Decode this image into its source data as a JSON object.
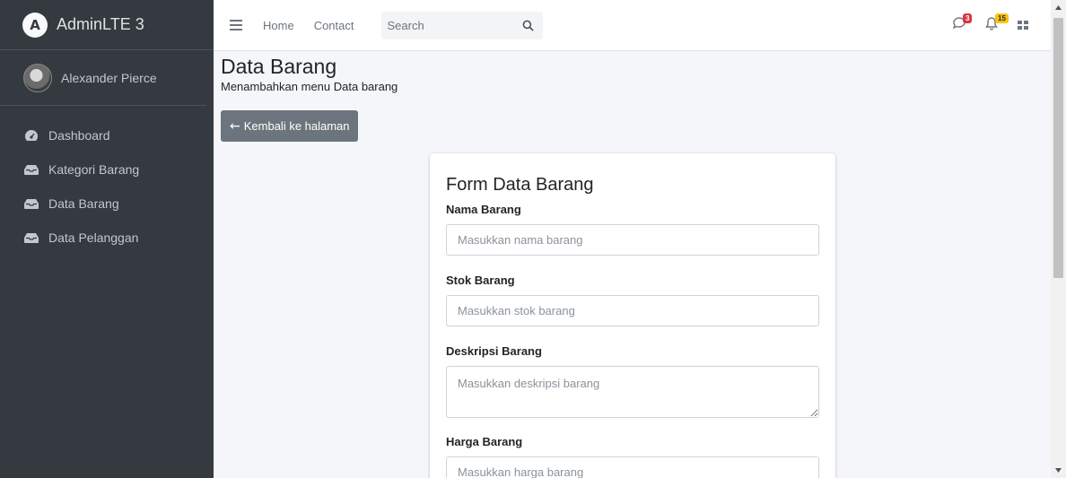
{
  "sidebar": {
    "brand": "AdminLTE 3",
    "brand_logo_letter": "A",
    "user_name": "Alexander Pierce",
    "items": [
      {
        "label": "Dashboard",
        "icon": "dashboard-icon"
      },
      {
        "label": "Kategori Barang",
        "icon": "inbox-icon"
      },
      {
        "label": "Data Barang",
        "icon": "inbox-icon"
      },
      {
        "label": "Data Pelanggan",
        "icon": "inbox-icon"
      }
    ]
  },
  "navbar": {
    "home_label": "Home",
    "contact_label": "Contact",
    "search_placeholder": "Search",
    "messages_badge": "3",
    "notifications_badge": "15"
  },
  "content": {
    "page_title": "Data Barang",
    "page_subtitle": "Menambahkan menu Data barang",
    "back_button_label": "Kembali ke halaman"
  },
  "form": {
    "title": "Form Data Barang",
    "fields": [
      {
        "label": "Nama Barang",
        "placeholder": "Masukkan nama barang"
      },
      {
        "label": "Stok Barang",
        "placeholder": "Masukkan stok barang"
      },
      {
        "label": "Deskripsi Barang",
        "placeholder": "Masukkan deskripsi barang"
      },
      {
        "label": "Harga Barang",
        "placeholder": "Masukkan harga barang"
      }
    ]
  },
  "colors": {
    "sidebar_bg": "#343a40",
    "content_bg": "#f4f6f9",
    "button_secondary": "#6c757d",
    "badge_danger": "#dc3545",
    "badge_warning": "#ffc107"
  }
}
